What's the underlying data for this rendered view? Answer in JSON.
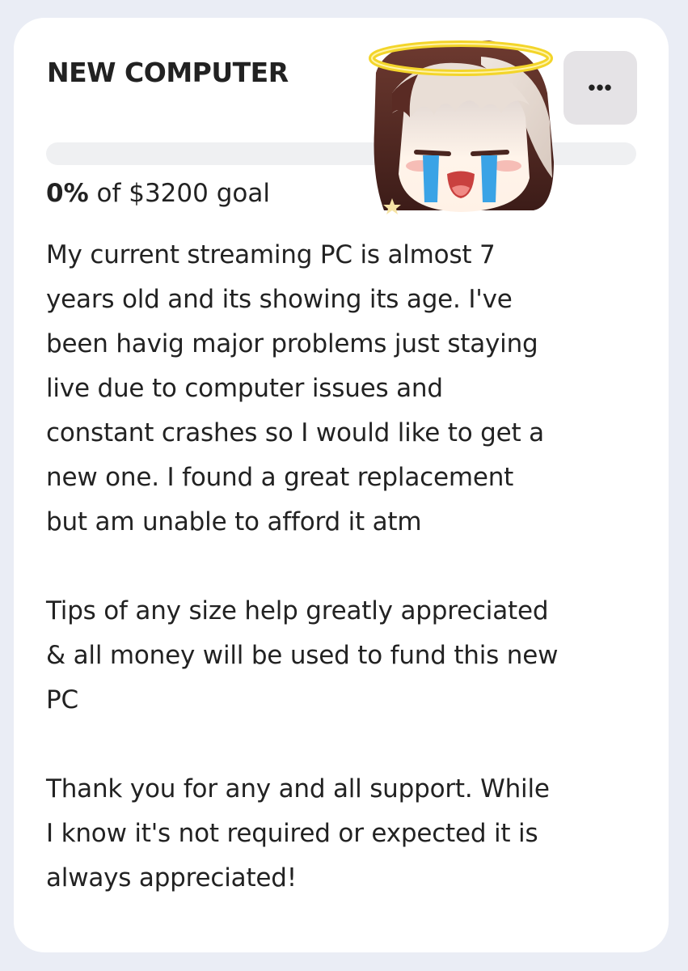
{
  "goal": {
    "title": "NEW COMPUTER",
    "menu_label": "•••",
    "progress_fraction": 0,
    "percent_label": "0%",
    "goal_suffix": " of $3200 goal",
    "description": [
      "My current streaming PC is almost 7\nyears old and its showing its age. I've\nbeen havig major problems just staying\nlive due to computer issues and\nconstant crashes so I would like to get a\nnew one. I found a great replacement\nbut am unable to afford it atm",
      "Tips of any size help greatly appreciated\n& all money will be used to fund this new\nPC",
      "Thank you for any and all support. While\nI know it's not required or expected it is\nalways appreciated!"
    ]
  },
  "colors": {
    "page_background": "#eaedf5",
    "card_background": "#ffffff",
    "progress_track": "#eff0f2",
    "menu_button": "#e5e3e6",
    "text": "#222222",
    "halo": "#f3d52a"
  },
  "icons": {
    "menu": "more-horizontal-icon",
    "sticker": "crying-anime-angel-sticker"
  }
}
